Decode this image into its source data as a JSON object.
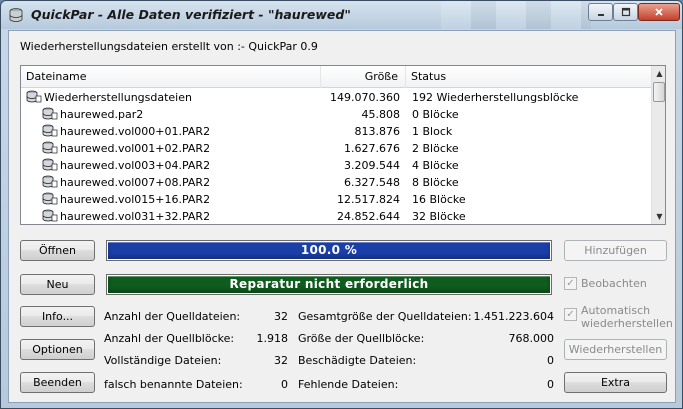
{
  "window": {
    "title": "QuickPar - Alle Daten verifiziert - \"haurewed\""
  },
  "created_by": "Wiederherstellungsdateien erstellt von :- QuickPar 0.9",
  "list": {
    "columns": [
      "Dateiname",
      "Größe",
      "Status"
    ],
    "rows": [
      {
        "name": "Wiederherstellungsdateien",
        "size": "149.070.360",
        "status": "192 Wiederherstellungsblöcke",
        "indent": 0
      },
      {
        "name": "haurewed.par2",
        "size": "45.808",
        "status": "0 Blöcke",
        "indent": 1
      },
      {
        "name": "haurewed.vol000+01.PAR2",
        "size": "813.876",
        "status": "1 Block",
        "indent": 1
      },
      {
        "name": "haurewed.vol001+02.PAR2",
        "size": "1.627.676",
        "status": "2 Blöcke",
        "indent": 1
      },
      {
        "name": "haurewed.vol003+04.PAR2",
        "size": "3.209.544",
        "status": "4 Blöcke",
        "indent": 1
      },
      {
        "name": "haurewed.vol007+08.PAR2",
        "size": "6.327.548",
        "status": "8 Blöcke",
        "indent": 1
      },
      {
        "name": "haurewed.vol015+16.PAR2",
        "size": "12.517.824",
        "status": "16 Blöcke",
        "indent": 1
      },
      {
        "name": "haurewed.vol031+32.PAR2",
        "size": "24.852.644",
        "status": "32 Blöcke",
        "indent": 1
      }
    ]
  },
  "buttons": {
    "open": "Öffnen",
    "new": "Neu",
    "info": "Info...",
    "options": "Optionen",
    "exit": "Beenden",
    "add": "Hinzufügen",
    "repair": "Wiederherstellen",
    "extra": "Extra"
  },
  "progress1": {
    "text": "100.0 %",
    "value": 1.0,
    "color": "#1b3fa8"
  },
  "progress2": {
    "text": "Reparatur nicht erforderlich",
    "value": 1.0,
    "color": "#0f5c1f"
  },
  "checkboxes": {
    "watch": "Beobachten",
    "auto_repair_1": "Automatisch",
    "auto_repair_2": "wiederherstellen"
  },
  "stats": {
    "source_files_label": "Anzahl der Quelldateien:",
    "source_files_value": "32",
    "source_blocks_label": "Anzahl der Quellblöcke:",
    "source_blocks_value": "1.918",
    "complete_files_label": "Vollständige Dateien:",
    "complete_files_value": "32",
    "misnamed_files_label": "falsch benannte Dateien:",
    "misnamed_files_value": "0",
    "total_size_label": "Gesamtgröße der Quelldateien:",
    "total_size_value": "1.451.223.604",
    "block_size_label": "Größe der Quellblöcke:",
    "block_size_value": "768.000",
    "damaged_files_label": "Beschädigte Dateien:",
    "damaged_files_value": "0",
    "missing_files_label": "Fehlende Dateien:",
    "missing_files_value": "0"
  }
}
